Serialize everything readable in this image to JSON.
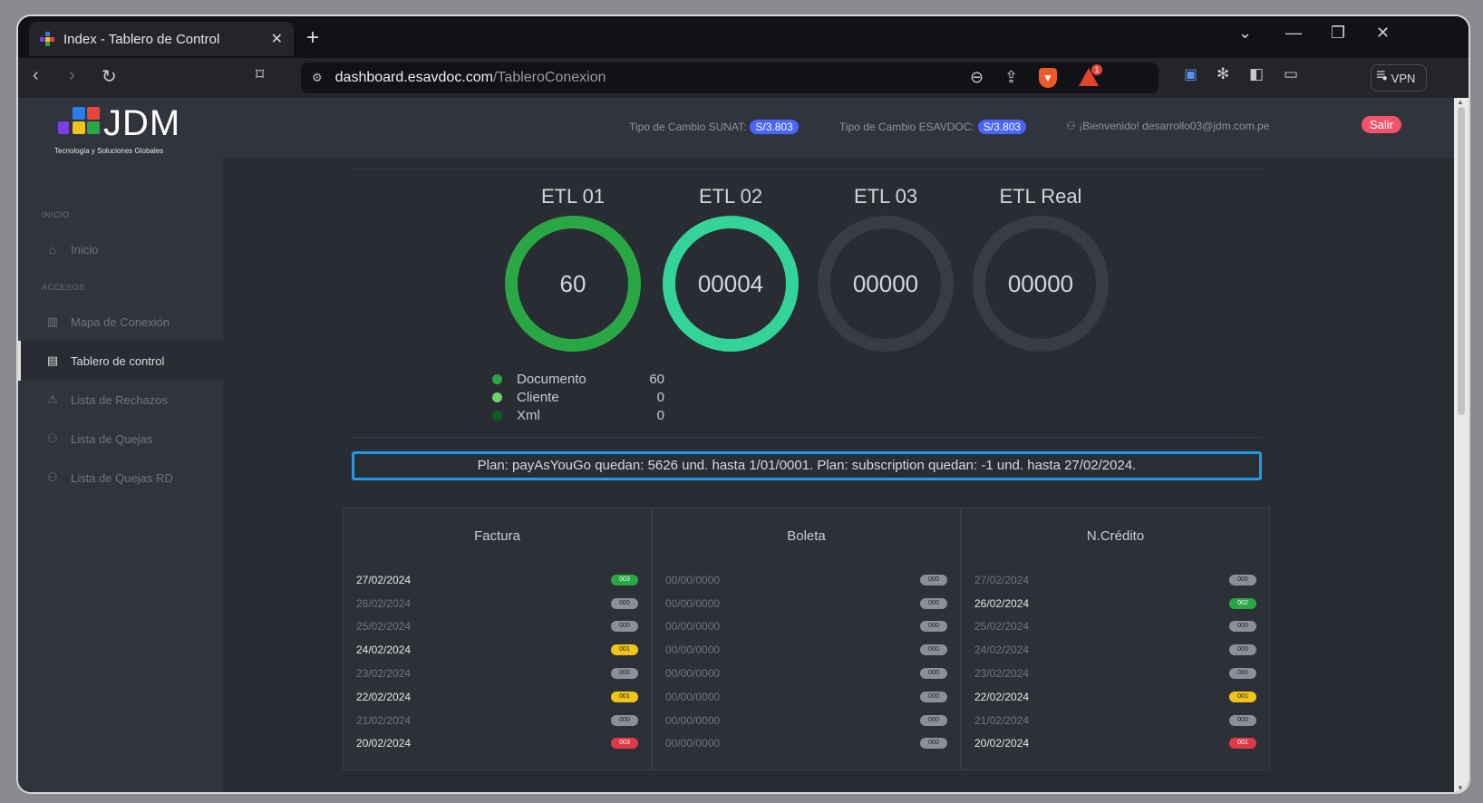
{
  "browser": {
    "tab_title": "Index - Tablero de Control",
    "tab_close": "✕",
    "new_tab": "+",
    "url_host": "dashboard.esavdoc.com",
    "url_path": "/TableroConexion",
    "vpn_label": "VPN",
    "alert_count": "1",
    "brave_glyph": "▼"
  },
  "header": {
    "logo_text": "JDM",
    "logo_tagline": "Tecnología y Soluciones Globales",
    "sunat_label": "Tipo de Cambio SUNAT:",
    "sunat_value": "S/3.803",
    "esavdoc_label": "Tipo de Cambio ESAVDOC:",
    "esavdoc_value": "S/3.803",
    "welcome": "¡Bienvenido! desarrollo03@jdm.com.pe",
    "logout": "Salir"
  },
  "sidebar": {
    "section_inicio": "INICIO",
    "section_accesos": "ACCESOS",
    "items": [
      {
        "label": "Inicio"
      },
      {
        "label": "Mapa de Conexión"
      },
      {
        "label": "Tablero de control"
      },
      {
        "label": "Lista de Rechazos"
      },
      {
        "label": "Lista de Quejas"
      },
      {
        "label": "Lista de Quejas RD"
      }
    ]
  },
  "gauges": [
    {
      "label": "ETL 01",
      "value": "60",
      "color": "#2aa745"
    },
    {
      "label": "ETL 02",
      "value": "00004",
      "color": "#34d399"
    },
    {
      "label": "ETL 03",
      "value": "00000",
      "color": "#3a3c45"
    },
    {
      "label": "ETL Real",
      "value": "00000",
      "color": "#3a3c45"
    }
  ],
  "legend": [
    {
      "name": "Documento",
      "value": "60",
      "color": "#2aa745"
    },
    {
      "name": "Cliente",
      "value": "0",
      "color": "#6fd36b"
    },
    {
      "name": "Xml",
      "value": "0",
      "color": "#0f5c1f"
    }
  ],
  "plan_text": "Plan: payAsYouGo quedan: 5626 und. hasta 1/01/0001. Plan: subscription quedan: -1 und. hasta 27/02/2024.",
  "cards": {
    "factura": {
      "title": "Factura",
      "rows": [
        {
          "date": "27/02/2024",
          "count": "003",
          "status": "green",
          "on": true
        },
        {
          "date": "26/02/2024",
          "count": "000",
          "status": "gray",
          "on": false
        },
        {
          "date": "25/02/2024",
          "count": "000",
          "status": "gray",
          "on": false
        },
        {
          "date": "24/02/2024",
          "count": "001",
          "status": "yellow",
          "on": true
        },
        {
          "date": "23/02/2024",
          "count": "000",
          "status": "gray",
          "on": false
        },
        {
          "date": "22/02/2024",
          "count": "001",
          "status": "yellow",
          "on": true
        },
        {
          "date": "21/02/2024",
          "count": "000",
          "status": "gray",
          "on": false
        },
        {
          "date": "20/02/2024",
          "count": "003",
          "status": "red",
          "on": true
        }
      ]
    },
    "boleta": {
      "title": "Boleta",
      "rows": [
        {
          "date": "00/00/0000",
          "count": "000",
          "status": "gray",
          "on": false
        },
        {
          "date": "00/00/0000",
          "count": "000",
          "status": "gray",
          "on": false
        },
        {
          "date": "00/00/0000",
          "count": "000",
          "status": "gray",
          "on": false
        },
        {
          "date": "00/00/0000",
          "count": "000",
          "status": "gray",
          "on": false
        },
        {
          "date": "00/00/0000",
          "count": "000",
          "status": "gray",
          "on": false
        },
        {
          "date": "00/00/0000",
          "count": "000",
          "status": "gray",
          "on": false
        },
        {
          "date": "00/00/0000",
          "count": "000",
          "status": "gray",
          "on": false
        },
        {
          "date": "00/00/0000",
          "count": "000",
          "status": "gray",
          "on": false
        }
      ]
    },
    "ncredito": {
      "title": "N.Crédito",
      "rows": [
        {
          "date": "27/02/2024",
          "count": "000",
          "status": "gray",
          "on": false
        },
        {
          "date": "26/02/2024",
          "count": "002",
          "status": "green",
          "on": true
        },
        {
          "date": "25/02/2024",
          "count": "000",
          "status": "gray",
          "on": false
        },
        {
          "date": "24/02/2024",
          "count": "000",
          "status": "gray",
          "on": false
        },
        {
          "date": "23/02/2024",
          "count": "000",
          "status": "gray",
          "on": false
        },
        {
          "date": "22/02/2024",
          "count": "001",
          "status": "yellow",
          "on": true
        },
        {
          "date": "21/02/2024",
          "count": "000",
          "status": "gray",
          "on": false
        },
        {
          "date": "20/02/2024",
          "count": "001",
          "status": "red",
          "on": true
        }
      ]
    }
  }
}
